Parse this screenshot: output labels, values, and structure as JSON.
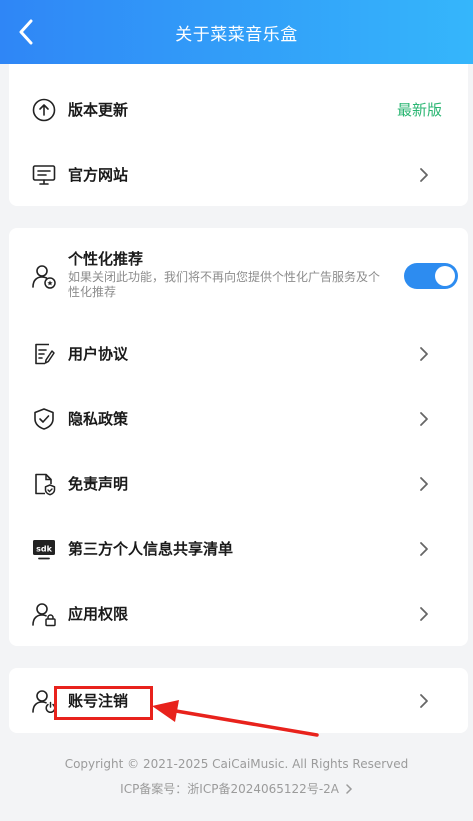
{
  "header": {
    "title": "关于菜菜音乐盒"
  },
  "about_card": {
    "update": {
      "label": "版本更新",
      "status": "最新版"
    },
    "website": {
      "label": "官方网站"
    }
  },
  "settings_card": {
    "recommend": {
      "title": "个性化推荐",
      "description": "如果关闭此功能，我们将不再向您提供个性化广告服务及个性化推荐",
      "enabled": true
    },
    "agreement": {
      "label": "用户协议"
    },
    "privacy": {
      "label": "隐私政策"
    },
    "disclaimer": {
      "label": "免责声明"
    },
    "third_party": {
      "label": "第三方个人信息共享清单"
    },
    "permissions": {
      "label": "应用权限"
    }
  },
  "account_card": {
    "cancel": {
      "label": "账号注销"
    }
  },
  "footer": {
    "copyright": "Copyright © 2021-2025 CaiCaiMusic. All Rights Reserved",
    "icp": "ICP备案号：浙ICP备2024065122号-2A"
  },
  "colors": {
    "header_start": "#2f86f6",
    "header_end": "#35b6fb",
    "status_green": "#2bb673",
    "toggle_on": "#2d8cf0",
    "annotation_red": "#e8221c"
  }
}
